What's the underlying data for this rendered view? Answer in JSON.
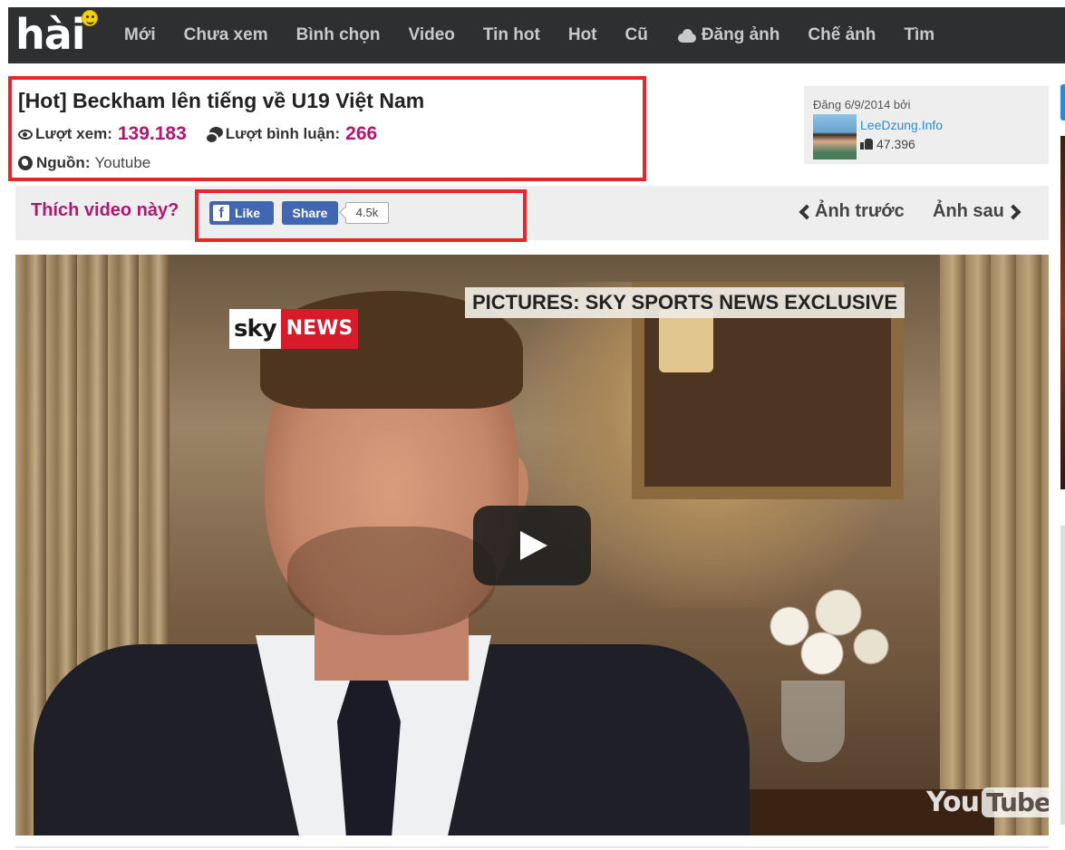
{
  "site": {
    "logo_text": "hài"
  },
  "nav": {
    "items": [
      "Mới",
      "Chưa xem",
      "Bình chọn",
      "Video",
      "Tin hot",
      "Hot",
      "Cũ"
    ],
    "upload_label": "Đăng ảnh",
    "make_label": "Chế ảnh",
    "search_label": "Tìm"
  },
  "post": {
    "title": "[Hot] Beckham lên tiếng về U19 Việt Nam",
    "views_label": "Lượt xem:",
    "views_value": "139.183",
    "comments_label": "Lượt bình luận:",
    "comments_value": "266",
    "source_label": "Nguồn:",
    "source_value": "Youtube"
  },
  "poster": {
    "posted_text": "Đăng 6/9/2014 bởi",
    "name": "LeeDzung.Info",
    "points": "47.396"
  },
  "social": {
    "like_prompt": "Thích video này?",
    "like_label": "Like",
    "share_label": "Share",
    "share_count": "4.5k",
    "prev_label": "Ảnh trước",
    "next_label": "Ảnh sau"
  },
  "video": {
    "channel_logo_sky": "sky",
    "channel_logo_news": "NEWS",
    "caption": "PICTURES: SKY SPORTS NEWS EXCLUSIVE",
    "yt_you": "You",
    "yt_tube": "Tube"
  },
  "colors": {
    "accent": "#b0176e",
    "highlight_border": "#e8252b",
    "facebook": "#4267b2",
    "nav_bg": "#2d2f31"
  }
}
